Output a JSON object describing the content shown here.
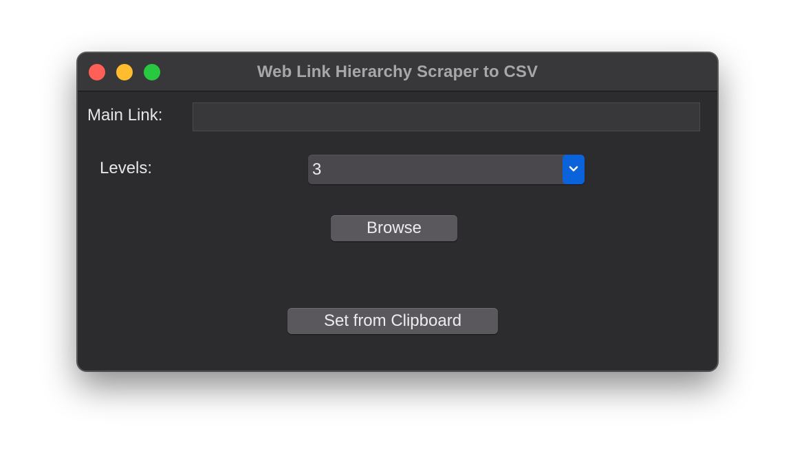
{
  "window": {
    "title": "Web Link Hierarchy Scraper to CSV",
    "traffic_lights": {
      "close_color": "#fe5f57",
      "minimize_color": "#febc2e",
      "zoom_color": "#28c840"
    }
  },
  "form": {
    "main_link_label": "Main Link:",
    "main_link_value": "",
    "levels_label": "Levels:",
    "levels_selected": "3",
    "levels_dropdown_icon": "chevron-down-icon",
    "browse_label": "Browse",
    "clipboard_label": "Set from Clipboard"
  },
  "colors": {
    "window_bg": "#2c2c2e",
    "titlebar_bg": "#38373a",
    "accent": "#0a63da",
    "button_bg": "#5a585d"
  }
}
